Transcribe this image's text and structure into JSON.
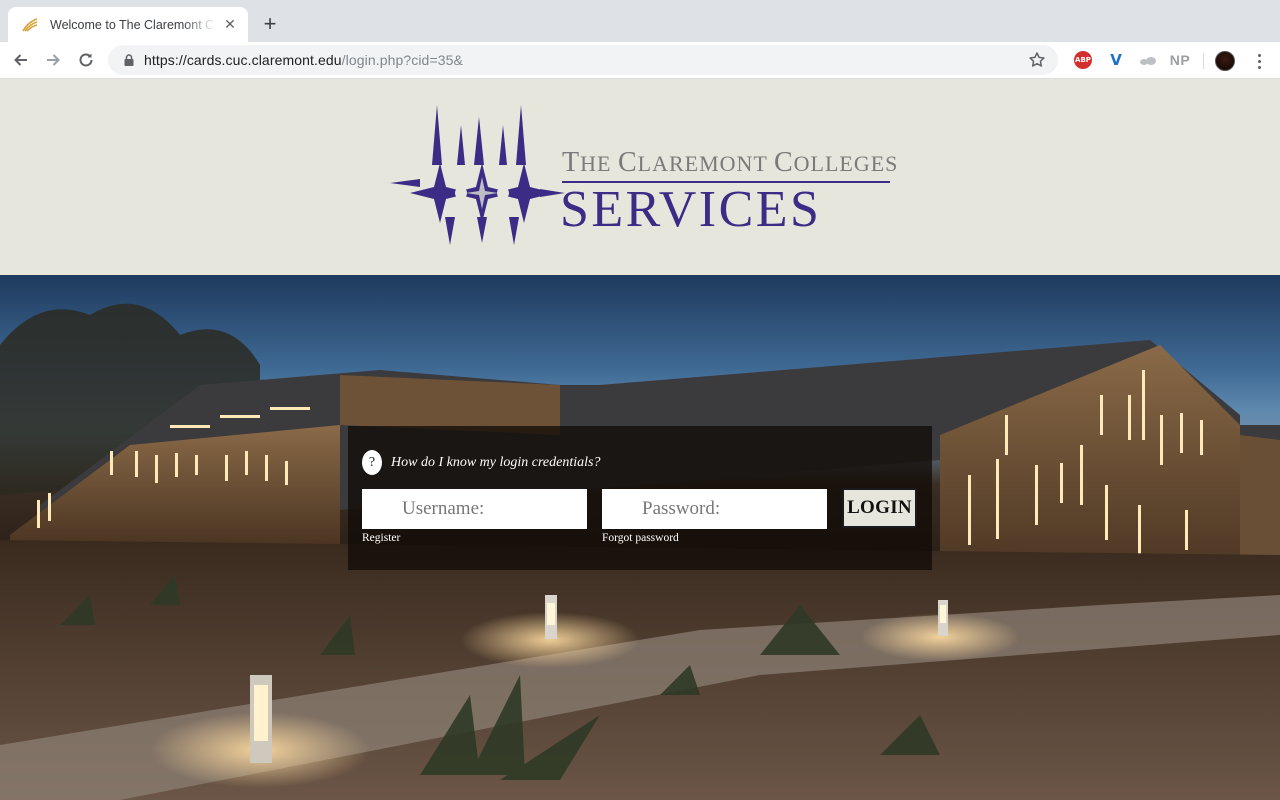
{
  "browser": {
    "tab_title": "Welcome to The Claremont Colleges Services",
    "new_tab_label": "+",
    "url_host": "https://cards.cuc.claremont.edu",
    "url_path": "/login.php?cid=35&",
    "extensions": {
      "abp_label": "ABP",
      "v_label": "V",
      "np_label": "NP"
    }
  },
  "header": {
    "logo_line1_a": "T",
    "logo_line1_b": "HE ",
    "logo_line1_c": "C",
    "logo_line1_d": "LAREMONT ",
    "logo_line1_e": "C",
    "logo_line1_f": "OLLEGES",
    "logo_line2": "SERVICES",
    "logo_color": "#3c2c86"
  },
  "login": {
    "help_icon": "?",
    "help_text": "How do I know my login credentials?",
    "username_placeholder": "Username:",
    "password_placeholder": "Password:",
    "login_label": "LOGIN",
    "register_label": "Register",
    "forgot_label": "Forgot password"
  }
}
